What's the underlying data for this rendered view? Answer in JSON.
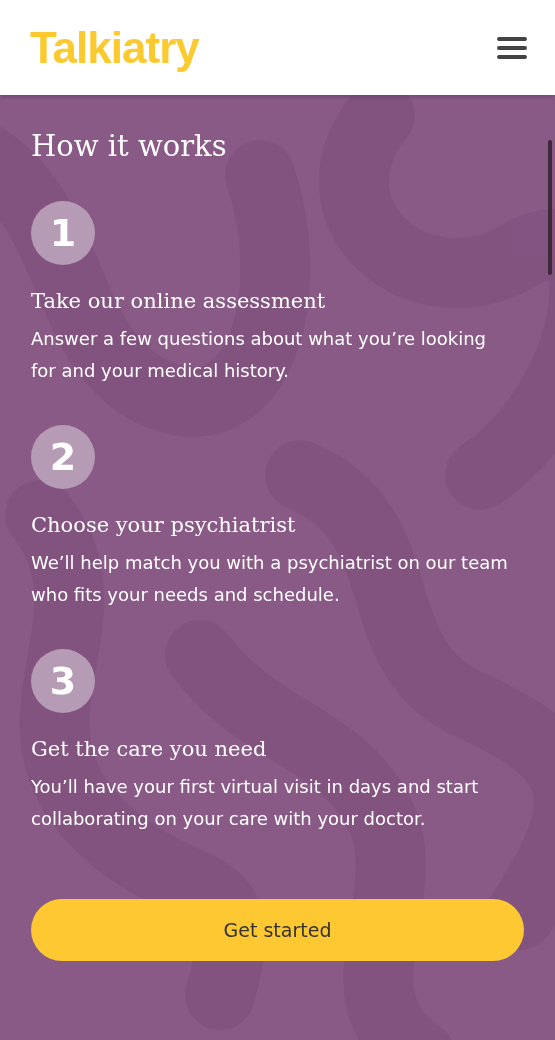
{
  "header": {
    "logo": "Talkiatry"
  },
  "section": {
    "heading": "How it works",
    "steps": [
      {
        "number": "1",
        "title": "Take our online assessment",
        "text": "Answer a few questions about what you’re looking for and your medical history."
      },
      {
        "number": "2",
        "title": "Choose your psychiatrist",
        "text": "We’ll help match you with a psychiatrist on our team who fits your needs and schedule."
      },
      {
        "number": "3",
        "title": "Get the care you need",
        "text": "You’ll have your first virtual visit in days and start collaborating on your care with your doctor."
      }
    ],
    "button": "Get started"
  }
}
